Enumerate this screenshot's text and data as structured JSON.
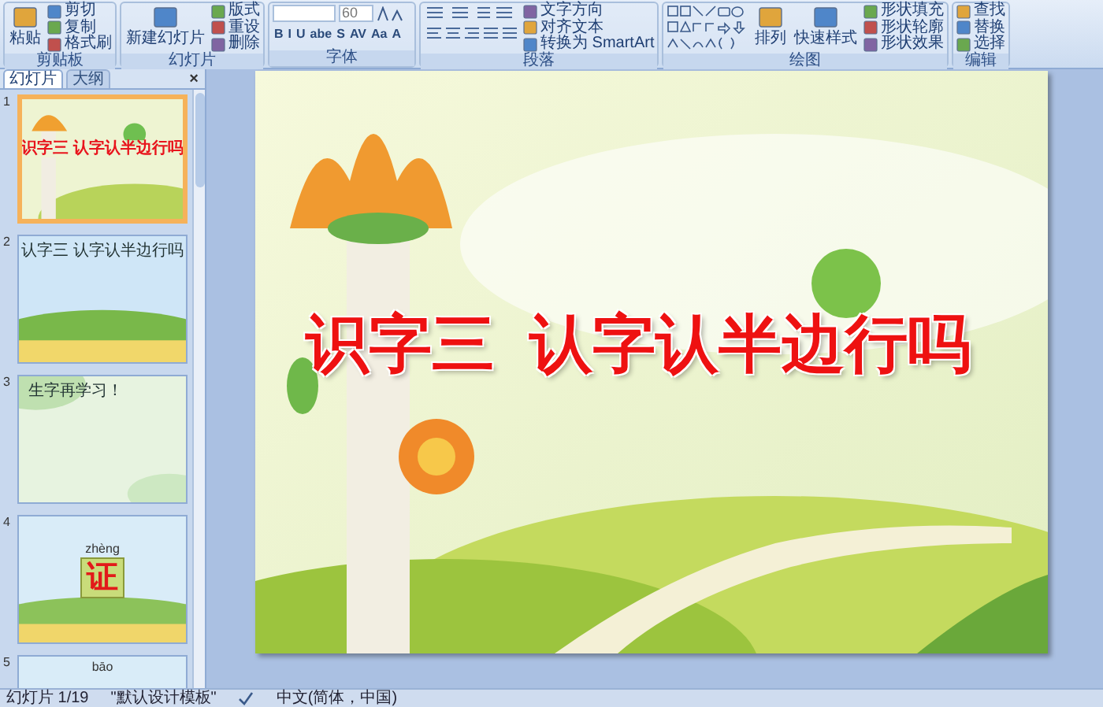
{
  "ribbon": {
    "groups": [
      {
        "label": "剪贴板",
        "items": [
          {
            "kind": "large",
            "label": "粘贴"
          },
          {
            "kind": "small",
            "label": "剪切"
          },
          {
            "kind": "small",
            "label": "复制"
          },
          {
            "kind": "small",
            "label": "格式刷"
          }
        ]
      },
      {
        "label": "幻灯片",
        "items": [
          {
            "kind": "large",
            "label": "新建幻灯片"
          },
          {
            "kind": "small",
            "label": "版式"
          },
          {
            "kind": "small",
            "label": "重设"
          },
          {
            "kind": "small",
            "label": "删除"
          }
        ]
      },
      {
        "label": "字体",
        "items": [
          {
            "kind": "field",
            "label": "60"
          },
          {
            "kind": "glyphs",
            "labels": [
              "B",
              "I",
              "U",
              "abe",
              "S",
              "AV",
              "Aa",
              "A"
            ]
          }
        ]
      },
      {
        "label": "段落",
        "items": [
          {
            "kind": "icons"
          },
          {
            "kind": "small",
            "label": "文字方向"
          },
          {
            "kind": "small",
            "label": "对齐文本"
          },
          {
            "kind": "small",
            "label": "转换为 SmartArt"
          }
        ]
      },
      {
        "label": "绘图",
        "items": [
          {
            "kind": "shapes"
          },
          {
            "kind": "large",
            "label": "排列"
          },
          {
            "kind": "large",
            "label": "快速样式"
          },
          {
            "kind": "small",
            "label": "形状填充"
          },
          {
            "kind": "small",
            "label": "形状轮廓"
          },
          {
            "kind": "small",
            "label": "形状效果"
          }
        ]
      },
      {
        "label": "编辑",
        "items": [
          {
            "kind": "small",
            "label": "查找"
          },
          {
            "kind": "small",
            "label": "替换"
          },
          {
            "kind": "small",
            "label": "选择"
          }
        ]
      }
    ]
  },
  "panel": {
    "tabs": [
      {
        "label": "幻灯片",
        "selected": true
      },
      {
        "label": "大纲",
        "selected": false
      }
    ],
    "close": "×",
    "slides": [
      {
        "number": "1",
        "selected": true,
        "kind": "title",
        "texts": [
          "识字三 认字认半边行吗"
        ]
      },
      {
        "number": "2",
        "selected": false,
        "kind": "list",
        "texts": [
          "认字三 认字认半边行吗"
        ]
      },
      {
        "number": "3",
        "selected": false,
        "kind": "study",
        "texts": [
          "生字再学习！"
        ]
      },
      {
        "number": "4",
        "selected": false,
        "kind": "card",
        "texts": [
          "zhèng",
          "证"
        ]
      },
      {
        "number": "5",
        "selected": false,
        "kind": "card",
        "texts": [
          "bāo"
        ]
      }
    ]
  },
  "slide": {
    "title": "识字三  认字认半边行吗"
  },
  "status_bar": {
    "slide": "幻灯片 1/19",
    "theme": "\"默认设计模板\"",
    "language": "中文(简体，中国)"
  }
}
